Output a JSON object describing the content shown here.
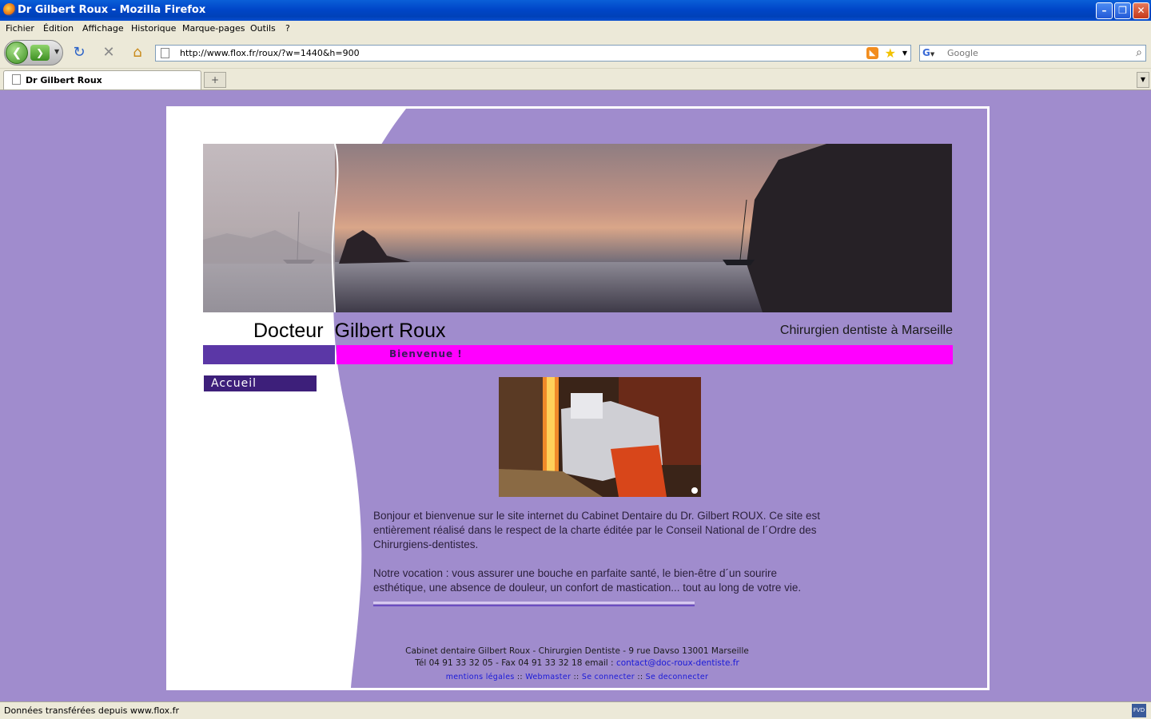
{
  "window": {
    "title": "Dr Gilbert Roux - Mozilla Firefox",
    "buttons": [
      "minimize",
      "maximize",
      "close"
    ]
  },
  "menubar": {
    "items": [
      "Fichier",
      "Édition",
      "Affichage",
      "Historique",
      "Marque-pages",
      "Outils",
      "?"
    ]
  },
  "navbar": {
    "url": "http://www.flox.fr/roux/?w=1440&h=900",
    "search_placeholder": "Google"
  },
  "tabs": [
    {
      "label": "Dr Gilbert Roux",
      "active": true
    }
  ],
  "site": {
    "title_part1": "Docteur",
    "title_part2": "Gilbert Roux",
    "subtitle": "Chirurgien dentiste à Marseille",
    "header_bar_label": "Bienvenue !",
    "nav": [
      {
        "label": "Accueil"
      }
    ],
    "intro_paragraphs": [
      "Bonjour et bienvenue sur le site internet du Cabinet Dentaire du Dr. Gilbert ROUX. Ce site est entièrement réalisé dans le respect de la charte éditée par le Conseil National de l´Ordre des Chirurgiens-dentistes.",
      "Notre vocation : vous assurer une bouche en parfaite santé, le bien-être d´un sourire esthétique, une absence de douleur, un confort de mastication... tout au long de votre vie."
    ],
    "footer": {
      "line1": "Cabinet dentaire Gilbert Roux - Chirurgien Dentiste - 9 rue Davso 13001 Marseille",
      "line2_prefix": "Tél 04 91 33 32 05 - Fax 04 91 33 32 18 email :",
      "email": "contact@doc-roux-dentiste.fr",
      "links": [
        "mentions légales",
        "Webmaster",
        "Se connecter",
        "Se deconnecter"
      ],
      "separator": "::"
    }
  },
  "statusbar": {
    "text": "Données transférées depuis www.flox.fr",
    "addon_label": "FVD"
  },
  "colors": {
    "page_bg": "#a08ccd",
    "bar_purple": "#5b37a6",
    "bar_magenta": "#ff00ff",
    "nav_bg": "#3d1f7a"
  }
}
